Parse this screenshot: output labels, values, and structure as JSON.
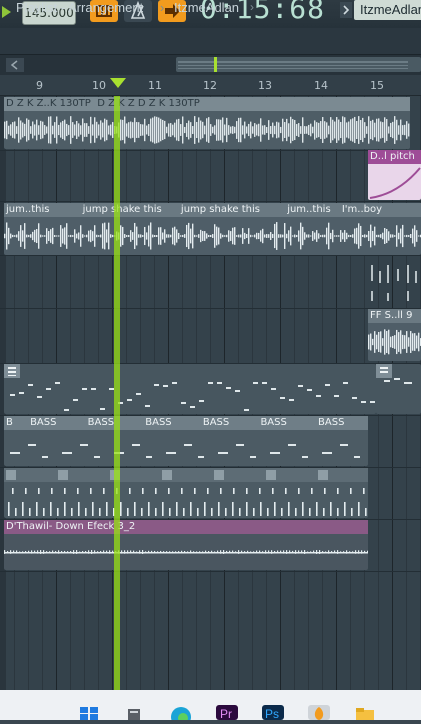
{
  "toolbar": {
    "tempo": "145.000",
    "time": "0:15:68",
    "user_label": "ItzmeAdlan",
    "colors": {
      "accent": "#f29b1e",
      "time": "#b8e0d2"
    }
  },
  "title_bar": {
    "title": "Playlist - Arrangement",
    "separator": "›",
    "pattern": "ItzmeAdlan",
    "more": "›"
  },
  "ruler": {
    "bars": [
      "9",
      "10",
      "11",
      "12",
      "13",
      "14",
      "15"
    ]
  },
  "tracks": {
    "t1_clip_label": "D Z K Z..K 130TP",
    "t1_clip_label_b": "D Z K Z D Z K 130TP",
    "t2_pitch_label": "D..l pitch",
    "t3_clip_a": "jum..this",
    "t3_clip_b": "jump shake this",
    "t3_clip_c": "jump shake this",
    "t3_clip_d": "jum..this",
    "t3_clip_e": "I'm..boy",
    "t4_clip_label": "FF S..ll 9",
    "t6_clip_a": "B",
    "t6_clip_label": "BASS",
    "t8_clip_label": "D'Thawil- Down Efeck 3_2"
  },
  "taskbar": {
    "icons": [
      "windows-start-icon",
      "file-icon",
      "edge-browser-icon",
      "premiere-icon",
      "photoshop-icon",
      "fl-studio-icon",
      "folder-icon"
    ]
  }
}
